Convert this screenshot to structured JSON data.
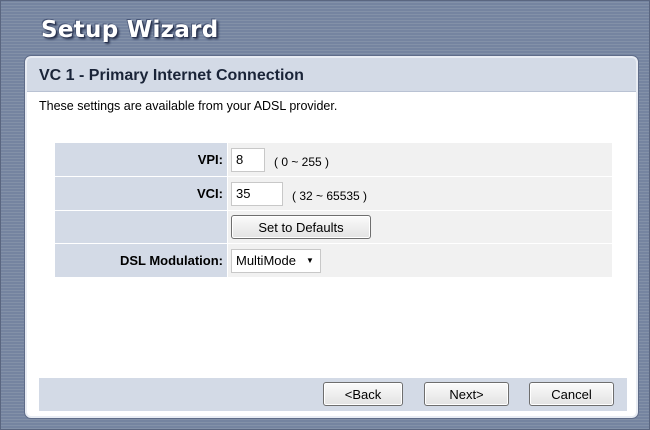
{
  "wizard": {
    "title": "Setup Wizard"
  },
  "panel": {
    "title": "VC 1 - Primary Internet Connection",
    "description": "These settings are available from your ADSL provider."
  },
  "form": {
    "vpi": {
      "label": "VPI:",
      "value": "8",
      "hint": "( 0 ~ 255 )"
    },
    "vci": {
      "label": "VCI:",
      "value": "35",
      "hint": "( 32 ~ 65535 )"
    },
    "defaults_button": "Set to Defaults",
    "modulation": {
      "label": "DSL Modulation:",
      "selected": "MultiMode"
    }
  },
  "footer": {
    "back": "<Back",
    "next": "Next>",
    "cancel": "Cancel"
  }
}
